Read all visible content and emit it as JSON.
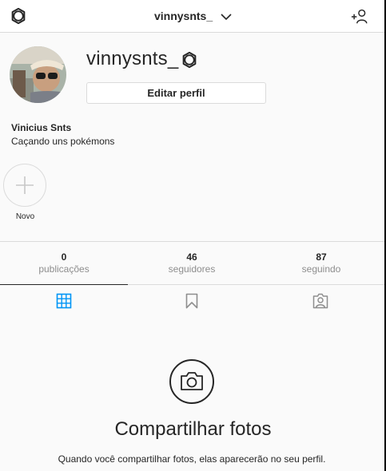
{
  "header": {
    "title": "vinnysnts_",
    "left_icon": "gear-icon",
    "dropdown_icon": "chevron-down-icon",
    "right_icon": "add-person-icon"
  },
  "profile": {
    "username": "vinnysnts_",
    "edit_button": "Editar perfil",
    "full_name": "Vinicius Snts",
    "bio": "Caçando uns pokémons"
  },
  "story": {
    "new_label": "Novo"
  },
  "stats": [
    {
      "count": "0",
      "label": "publicações"
    },
    {
      "count": "46",
      "label": "seguidores"
    },
    {
      "count": "87",
      "label": "seguindo"
    }
  ],
  "tabs": [
    {
      "icon": "grid-icon",
      "active": true
    },
    {
      "icon": "bookmark-icon",
      "active": false
    },
    {
      "icon": "tagged-icon",
      "active": false
    }
  ],
  "empty_state": {
    "icon": "camera-icon",
    "title": "Compartilhar fotos",
    "text": "Quando você compartilhar fotos, elas aparecerão no seu perfil."
  },
  "colors": {
    "text": "#262626",
    "muted": "#8e8e8e",
    "border": "#dbdbdb",
    "accent": "#0095f6"
  }
}
